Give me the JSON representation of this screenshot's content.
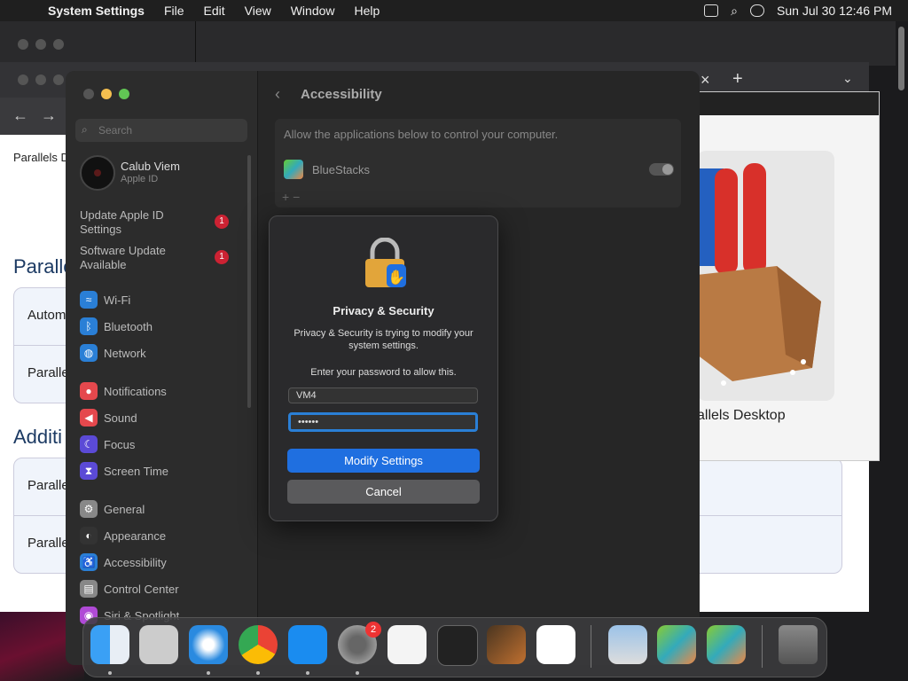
{
  "menubar": {
    "app": "System Settings",
    "items": [
      "File",
      "Edit",
      "View",
      "Window",
      "Help"
    ],
    "clock": "Sun Jul 30  12:46 PM"
  },
  "browser": {
    "subtitle": "Parallels D",
    "heading1": "Paralle",
    "heading2": "Additi",
    "card1": [
      "Autom",
      "Paralle"
    ],
    "card2": [
      "Paralle",
      "Paralle"
    ],
    "panel_label": "allels Desktop"
  },
  "sidebar": {
    "search_placeholder": "Search",
    "profile": {
      "name": "Calub Viem",
      "sub": "Apple ID"
    },
    "notices": [
      {
        "label": "Update Apple ID Settings",
        "badge": "1"
      },
      {
        "label": "Software Update Available",
        "badge": "1"
      }
    ],
    "items": [
      {
        "label": "Wi-Fi",
        "icon": "wifi-icon",
        "color": "#2a7fd6"
      },
      {
        "label": "Bluetooth",
        "icon": "bluetooth-icon",
        "color": "#2a7fd6"
      },
      {
        "label": "Network",
        "icon": "globe-icon",
        "color": "#2a7fd6"
      },
      {
        "label": "Notifications",
        "icon": "bell-icon",
        "color": "#e5484d"
      },
      {
        "label": "Sound",
        "icon": "speaker-icon",
        "color": "#e5484d"
      },
      {
        "label": "Focus",
        "icon": "moon-icon",
        "color": "#5b4ad6"
      },
      {
        "label": "Screen Time",
        "icon": "hourglass-icon",
        "color": "#5b4ad6"
      },
      {
        "label": "General",
        "icon": "gear-icon",
        "color": "#888888"
      },
      {
        "label": "Appearance",
        "icon": "appearance-icon",
        "color": "#333333"
      },
      {
        "label": "Accessibility",
        "icon": "accessibility-icon",
        "color": "#2a7fd6"
      },
      {
        "label": "Control Center",
        "icon": "control-center-icon",
        "color": "#888888"
      },
      {
        "label": "Siri & Spotlight",
        "icon": "siri-icon",
        "color": "#b04ad6"
      }
    ]
  },
  "main": {
    "title": "Accessibility",
    "description": "Allow the applications below to control your computer.",
    "app": "BlueStacks",
    "add_remove": "+  −"
  },
  "dialog": {
    "title": "Privacy & Security",
    "message": "Privacy & Security is trying to modify your system settings.",
    "prompt": "Enter your password to allow this.",
    "username": "VM4",
    "password": "••••••",
    "primary": "Modify Settings",
    "secondary": "Cancel",
    "accent": "#1f6fe0"
  },
  "dock": {
    "apps": [
      "finder-icon",
      "launchpad-icon",
      "safari-icon",
      "chrome-icon",
      "app-store-icon",
      "system-settings-icon",
      "textedit-icon",
      "terminal-icon",
      "garageband-icon",
      "vscode-icon",
      "preview-icon",
      "bluestacks-icon",
      "bluestacks-x-icon",
      "trash-icon"
    ],
    "settings_badge": "2"
  }
}
